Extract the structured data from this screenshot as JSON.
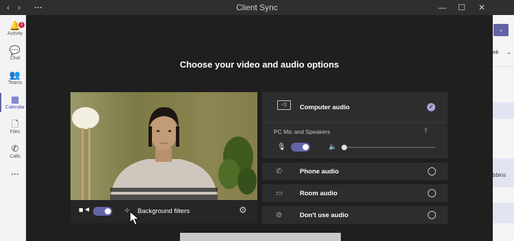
{
  "window": {
    "back_glyph": "‹",
    "forward_glyph": "›",
    "more_glyph": "···",
    "title": "Client Sync",
    "minimize_glyph": "—",
    "maximize_glyph": "☐",
    "close_glyph": "✕"
  },
  "sidebar": {
    "activity_badge": "1",
    "items": [
      {
        "label": "Activity",
        "icon": "bell-icon",
        "glyph": "🔔"
      },
      {
        "label": "Chat",
        "icon": "chat-icon",
        "glyph": "💬"
      },
      {
        "label": "Teams",
        "icon": "teams-icon",
        "glyph": "👥"
      },
      {
        "label": "Calendar",
        "icon": "calendar-icon",
        "glyph": "▦"
      },
      {
        "label": "Files",
        "icon": "files-icon",
        "glyph": "🗋"
      },
      {
        "label": "Calls",
        "icon": "calls-icon",
        "glyph": "✆"
      }
    ],
    "more_glyph": "···"
  },
  "right_pane": {
    "partial_dropdown": "ek",
    "partial_name": "bbins",
    "accent": "#6264a7"
  },
  "dialog": {
    "title": "Choose your video and audio options",
    "video": {
      "camera_on": true,
      "background_filters_label": "Background filters"
    },
    "audio": {
      "options": [
        {
          "label": "Computer audio",
          "icon": "computer-audio-icon",
          "selected": true
        },
        {
          "label": "Phone audio",
          "icon": "phone-icon",
          "selected": false
        },
        {
          "label": "Room audio",
          "icon": "room-icon",
          "selected": false
        },
        {
          "label": "Don't use audio",
          "icon": "no-audio-icon",
          "selected": false
        }
      ],
      "device_label": "PC Mic and Speakers",
      "mic_on": true,
      "speaker_volume": 0
    }
  },
  "colors": {
    "accent": "#6264a7",
    "background": "#1f1f1f",
    "card": "#2d2d2d"
  }
}
